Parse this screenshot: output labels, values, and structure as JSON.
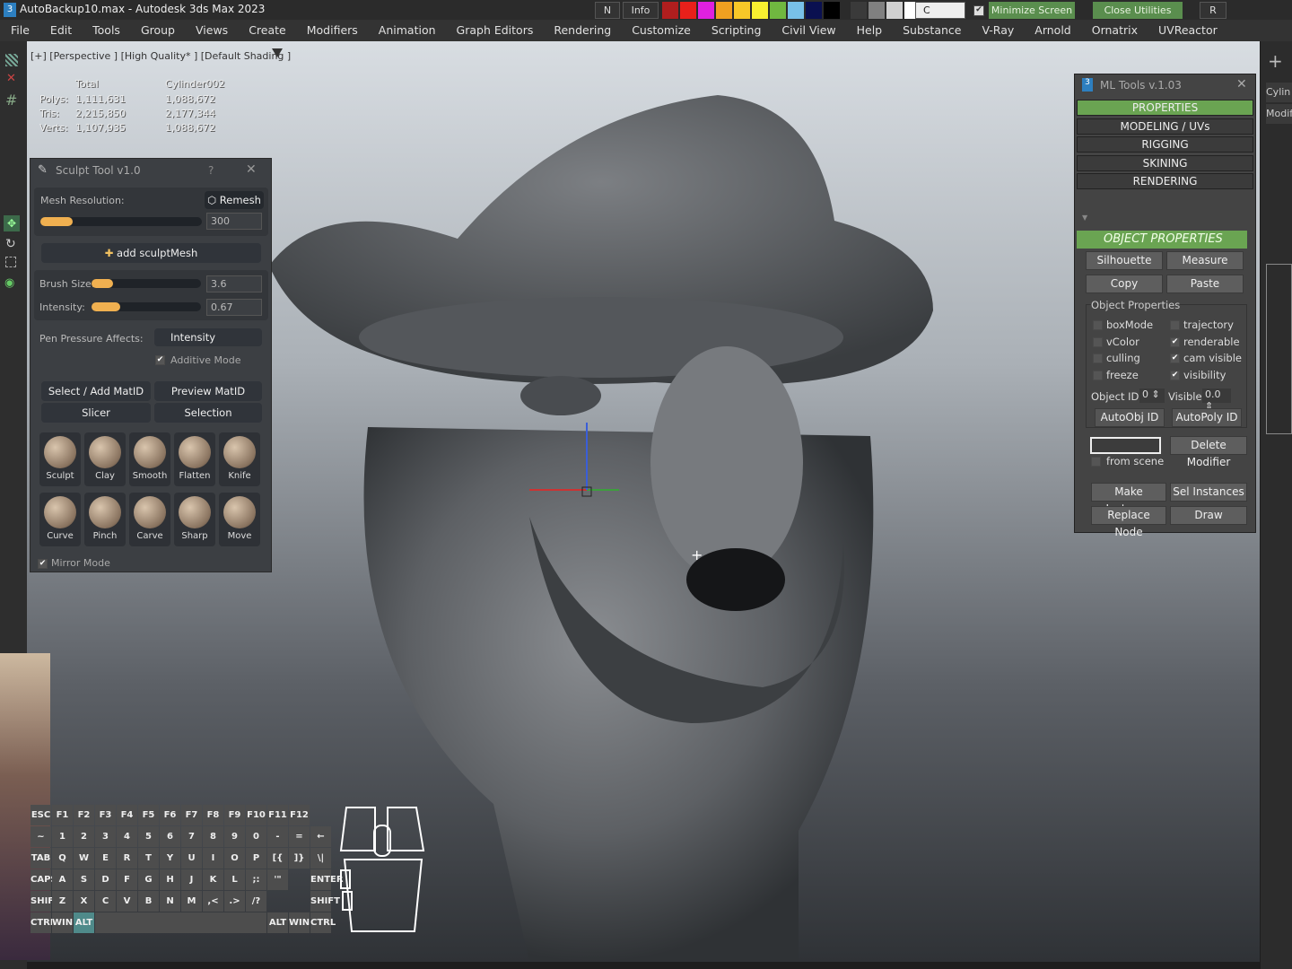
{
  "titlebar": {
    "title": "AutoBackup10.max - Autodesk 3ds Max 2023",
    "n": "N",
    "info": "Info",
    "c": "C",
    "minimize": "Minimize Screen",
    "minimize_checked": true,
    "close_utilities": "Close Utilities",
    "r": "R",
    "swatches": [
      "#b01e1e",
      "#e8201a",
      "#e020e0",
      "#f0a020",
      "#f8c828",
      "#f8f030",
      "#70b840",
      "#78c0e8",
      "#0a1050",
      "#000000",
      "#3a3a3a",
      "#808080",
      "#d0d0d0",
      "#ffffff"
    ]
  },
  "menu": [
    "File",
    "Edit",
    "Tools",
    "Group",
    "Views",
    "Create",
    "Modifiers",
    "Animation",
    "Graph Editors",
    "Rendering",
    "Customize",
    "Scripting",
    "Civil View",
    "Help",
    "Substance",
    "V-Ray",
    "Arnold",
    "Ornatrix",
    "UVReactor"
  ],
  "viewport": {
    "label": "[+] [Perspective ] [High Quality* ] [Default Shading ]",
    "stats": {
      "col_total": "Total",
      "col_obj": "Cylinder002",
      "rows": [
        [
          "Polys:",
          "1,111,631",
          "1,088,672"
        ],
        [
          "Tris:",
          "2,215,850",
          "2,177,344"
        ],
        [
          "Verts:",
          "1,107,935",
          "1,088,672"
        ]
      ]
    }
  },
  "sculpt": {
    "title": "Sculpt Tool v1.0",
    "help": "?",
    "mesh_res_label": "Mesh Resolution:",
    "remesh": "Remesh",
    "mesh_res": "300",
    "mesh_res_fill": 0.08,
    "add_mesh": "add sculptMesh",
    "brush_size_label": "Brush Size:",
    "brush_size": "3.6",
    "brush_size_fill": 0.12,
    "intensity_label": "Intensity:",
    "intensity": "0.67",
    "intensity_fill": 0.18,
    "pen_label": "Pen Pressure Affects:",
    "pen_value": "Intensity",
    "additive": "Additive Mode",
    "additive_checked": true,
    "select_matid": "Select / Add MatID",
    "preview_matid": "Preview MatID",
    "slicer": "Slicer",
    "selection": "Selection",
    "brushes": [
      "Sculpt",
      "Clay",
      "Smooth",
      "Flatten",
      "Knife",
      "Curve",
      "Pinch",
      "Carve",
      "Sharp",
      "Move"
    ],
    "mirror": "Mirror Mode",
    "mirror_checked": true
  },
  "ml": {
    "title": "ML Tools v.1.03",
    "tabs": [
      "PROPERTIES",
      "MODELING / UVs",
      "RIGGING",
      "SKINING",
      "RENDERING"
    ],
    "active_tab": 0,
    "section": "OBJECT PROPERTIES",
    "silhouette": "Silhouette",
    "measure": "Measure",
    "copy": "Copy",
    "paste": "Paste",
    "group": "Object Properties",
    "checks": [
      {
        "label": "boxMode",
        "on": false
      },
      {
        "label": "trajectory",
        "on": false
      },
      {
        "label": "vColor",
        "on": false
      },
      {
        "label": "renderable",
        "on": true
      },
      {
        "label": "culling",
        "on": false
      },
      {
        "label": "cam visible",
        "on": true
      },
      {
        "label": "freeze",
        "on": false
      },
      {
        "label": "visibility",
        "on": true
      }
    ],
    "objid_label": "Object ID:",
    "objid": "0",
    "visible_label": "Visible:",
    "visible": "0.0",
    "autoobj": "AutoObj ID",
    "autopoly": "AutoPoly ID",
    "delete_mod": "Delete Modifier",
    "from_scene": "from scene",
    "make_instance": "Make Instance",
    "sel_instances": "Sel Instances",
    "replace_node": "Replace Node",
    "draw": "Draw"
  },
  "rightpanel": {
    "obj": "Cylin",
    "mod": "Modif"
  },
  "keyboard": {
    "rows": [
      [
        "ESC",
        "F1",
        "F2",
        "F3",
        "F4",
        "F5",
        "F6",
        "F7",
        "F8",
        "F9",
        "F10",
        "F11",
        "F12"
      ],
      [
        "~",
        "1",
        "2",
        "3",
        "4",
        "5",
        "6",
        "7",
        "8",
        "9",
        "0",
        "-",
        "=",
        "←"
      ],
      [
        "TAB",
        "Q",
        "W",
        "E",
        "R",
        "T",
        "Y",
        "U",
        "I",
        "O",
        "P",
        "[{",
        "]}",
        "\\|"
      ],
      [
        "CAPS",
        "A",
        "S",
        "D",
        "F",
        "G",
        "H",
        "J",
        "K",
        "L",
        ";:",
        "'\"",
        "",
        "ENTER"
      ],
      [
        "SHIFT",
        "Z",
        "X",
        "C",
        "V",
        "B",
        "N",
        "M",
        ",<",
        ".>",
        "/?",
        "",
        "",
        "SHIFT"
      ],
      [
        "CTRL",
        "WIN",
        "ALT",
        "",
        "ALT",
        "WIN",
        "CTRL"
      ]
    ],
    "active": "ALT"
  }
}
